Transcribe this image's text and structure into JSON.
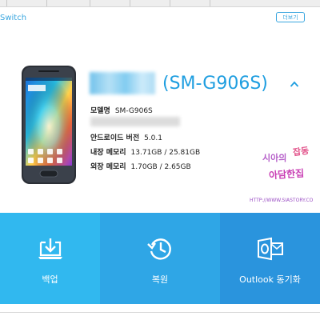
{
  "app": {
    "title": "Switch",
    "more_label": "더보기"
  },
  "device": {
    "model_title": "(SM-G906S)",
    "info": [
      {
        "label": "모델명",
        "value": "SM-G906S"
      },
      {
        "label": "안드로이드 버전",
        "value": "5.0.1"
      },
      {
        "label": "내장 메모리",
        "value": "13.71GB / 25.81GB"
      },
      {
        "label": "외장 메모리",
        "value": "1.70GB / 2.65GB"
      }
    ]
  },
  "watermark": {
    "line1": "시아의",
    "line2": "잡동",
    "line3": "아담한집",
    "url": "HTTP://WWW.SIASTORY.CO"
  },
  "actions": [
    {
      "label": "백업",
      "color": "#31b8ef",
      "icon": "backup-download-icon"
    },
    {
      "label": "복원",
      "color": "#2fa6e6",
      "icon": "restore-history-icon"
    },
    {
      "label": "Outlook 동기화",
      "color": "#2a94dd",
      "icon": "outlook-icon"
    }
  ],
  "colors": {
    "accent": "#1f9ee0",
    "link": "#3aa6df"
  }
}
